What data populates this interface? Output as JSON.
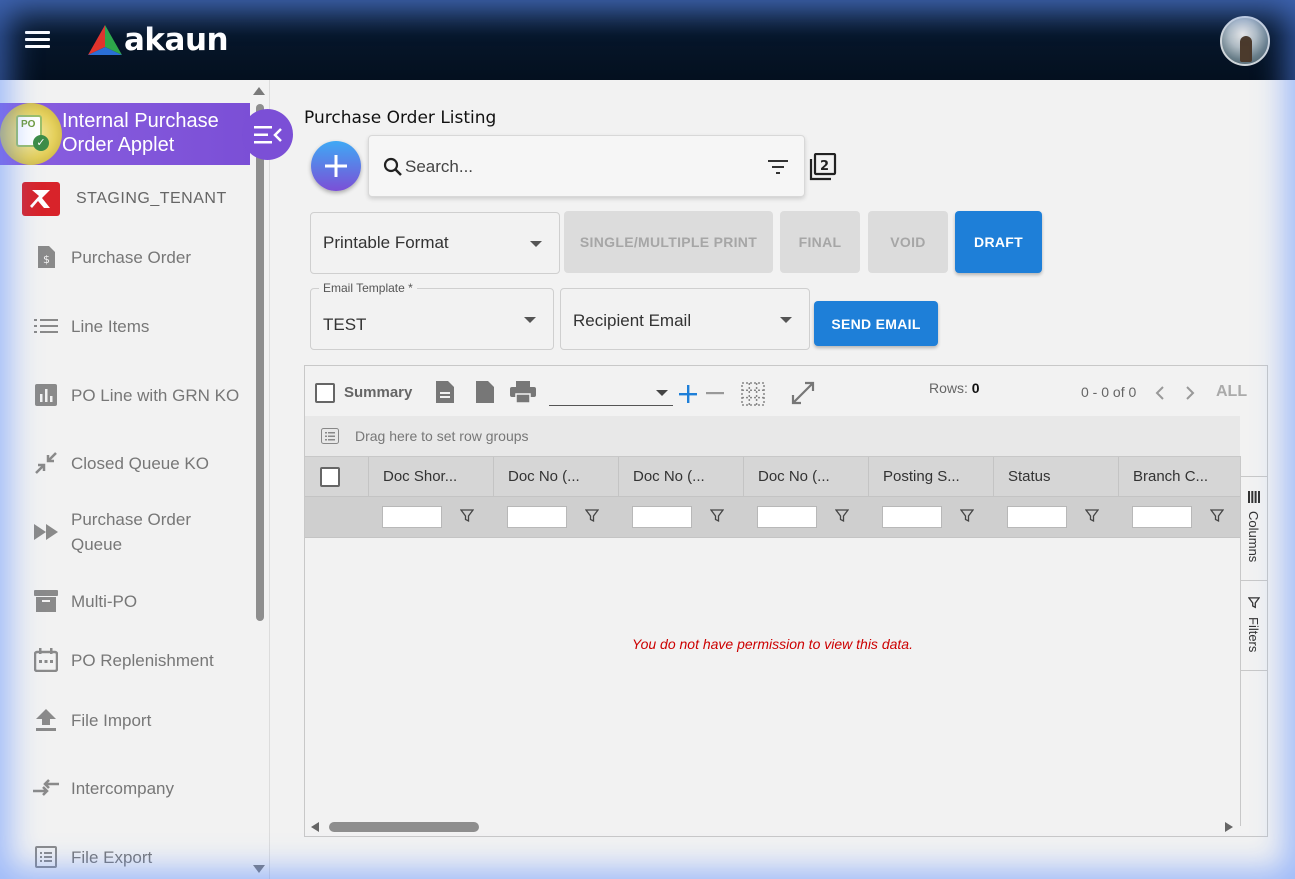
{
  "app": {
    "brand": "akaun",
    "accent": "#7b4fd6",
    "primary": "#1e7fd8"
  },
  "topbar": {
    "menu_icon": "hamburger-icon",
    "avatar_icon": "user-avatar"
  },
  "sidebar": {
    "applet_title_line1": "Internal Purchase",
    "applet_title_line2": "Order Applet",
    "applet_icon_text": "PO",
    "tenant": "STAGING_TENANT",
    "items": [
      {
        "label": "Purchase Order",
        "icon": "dollar-document-icon"
      },
      {
        "label": "Line Items",
        "icon": "list-icon"
      },
      {
        "label": "PO Line with GRN KO",
        "icon": "bar-chart-icon"
      },
      {
        "label": "Closed Queue KO",
        "icon": "collapse-arrows-icon"
      },
      {
        "label": "Purchase Order",
        "label2": "Queue",
        "icon": "fast-forward-icon"
      },
      {
        "label": "Multi-PO",
        "icon": "archive-box-icon"
      },
      {
        "label": "PO Replenishment",
        "icon": "calendar-icon"
      },
      {
        "label": "File Import",
        "icon": "upload-icon"
      },
      {
        "label": "Intercompany",
        "icon": "swap-arrows-icon"
      },
      {
        "label": "File Export",
        "icon": "list-document-icon"
      }
    ]
  },
  "main": {
    "title": "Purchase Order Listing",
    "search_placeholder": "Search...",
    "printable_format": "Printable Format",
    "buttons": {
      "print": "SINGLE/MULTIPLE PRINT",
      "final": "FINAL",
      "void": "VOID",
      "draft": "DRAFT",
      "send_email": "SEND EMAIL"
    },
    "email_template_label": "Email Template *",
    "email_template_value": "TEST",
    "recipient_email": "Recipient Email"
  },
  "grid": {
    "summary_label": "Summary",
    "rows_label": "Rows:",
    "rows_value": "0",
    "pagination": "0 - 0 of 0",
    "all_label": "ALL",
    "group_hint": "Drag here to set row groups",
    "columns": [
      "Doc Shor...",
      "Doc No (...",
      "Doc No (...",
      "Doc No (...",
      "Posting S...",
      "Status",
      "Branch C..."
    ],
    "side_tabs": {
      "columns": "Columns",
      "filters": "Filters"
    },
    "message": "You do not have permission to view this data."
  }
}
